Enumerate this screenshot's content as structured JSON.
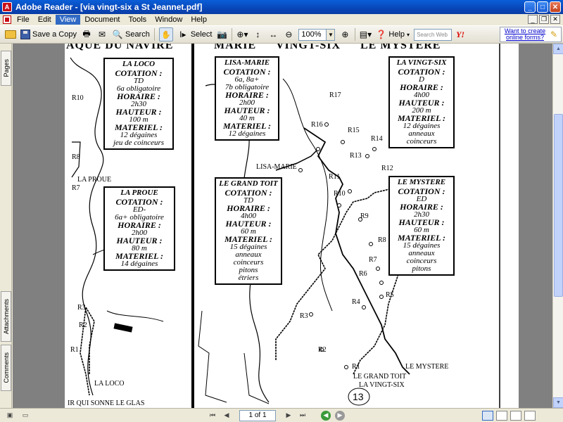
{
  "window": {
    "title": "Adobe Reader - [via vingt-six a St Jeannet.pdf]",
    "app_icon": "adobe-reader-icon"
  },
  "menu": {
    "items": [
      "File",
      "Edit",
      "View",
      "Document",
      "Tools",
      "Window",
      "Help"
    ],
    "active": "View"
  },
  "toolbar": {
    "save_copy_label": "Save a Copy",
    "search_label": "Search",
    "select_label": "Select",
    "zoom_value": "100%",
    "help_label": "Help",
    "search_web_placeholder": "Search Web",
    "yahoo_label": "Y!",
    "promo_text": "Want to create online forms?"
  },
  "nav_panel": {
    "tabs": [
      "Pages",
      "Attachments",
      "Comments"
    ]
  },
  "status": {
    "page_indicator": "1 of 1"
  },
  "topo": {
    "headers": {
      "left": "AQUE DU NAVIRE",
      "mid1": "MARIE",
      "mid2": "VINGT-SIX",
      "mid3": "LE MYSTERE"
    },
    "footer_left": "IR QUI SONNE LE GLAS",
    "page_number": "13",
    "boxes": {
      "la_loco": {
        "title": "LA LOCO",
        "lines": [
          {
            "k": "COTATION :",
            "v": "TD"
          },
          {
            "k": "",
            "v": "6a obligatoire"
          },
          {
            "k": "HORAIRE :",
            "v": "2h30"
          },
          {
            "k": "HAUTEUR :",
            "v": "100 m"
          },
          {
            "k": "MATERIEL :",
            "v": "12 dégaines"
          },
          {
            "k": "",
            "v": "jeu de coinceurs"
          }
        ]
      },
      "la_proue": {
        "title": "LA PROUE",
        "lines": [
          {
            "k": "COTATION :",
            "v": "ED-"
          },
          {
            "k": "",
            "v": "6a+ obligatoire"
          },
          {
            "k": "HORAIRE :",
            "v": "2h00"
          },
          {
            "k": "HAUTEUR :",
            "v": "80 m"
          },
          {
            "k": "MATERIEL :",
            "v": "14 dégaines"
          }
        ]
      },
      "lisa_marie": {
        "title": "LISA-MARIE",
        "lines": [
          {
            "k": "COTATION :",
            "v": "6a, 8a+"
          },
          {
            "k": "",
            "v": "7b obligatoire"
          },
          {
            "k": "HORAIRE :",
            "v": "2h00"
          },
          {
            "k": "HAUTEUR :",
            "v": "40 m"
          },
          {
            "k": "MATERIEL :",
            "v": "12 dégaines"
          }
        ]
      },
      "la_vingt_six": {
        "title": "LA VINGT-SIX",
        "lines": [
          {
            "k": "COTATION :",
            "v": "D"
          },
          {
            "k": "HORAIRE :",
            "v": "4h00"
          },
          {
            "k": "HAUTEUR :",
            "v": "200 m"
          },
          {
            "k": "MATERIEL :",
            "v": "12 dégaines"
          },
          {
            "k": "",
            "v": "anneaux"
          },
          {
            "k": "",
            "v": "coinceurs"
          }
        ]
      },
      "le_grand_toit": {
        "title": "LE GRAND TOIT",
        "lines": [
          {
            "k": "COTATION :",
            "v": "TD"
          },
          {
            "k": "HORAIRE :",
            "v": "4h00"
          },
          {
            "k": "HAUTEUR :",
            "v": "60 m"
          },
          {
            "k": "MATERIEL :",
            "v": "15 dégaines"
          },
          {
            "k": "",
            "v": "anneaux"
          },
          {
            "k": "",
            "v": "coinceurs"
          },
          {
            "k": "",
            "v": "pitons"
          },
          {
            "k": "",
            "v": "étriers"
          }
        ]
      },
      "le_mystere": {
        "title": "LE MYSTERE",
        "lines": [
          {
            "k": "COTATION :",
            "v": "ED"
          },
          {
            "k": "HORAIRE :",
            "v": "2h30"
          },
          {
            "k": "HAUTEUR :",
            "v": "60 m"
          },
          {
            "k": "MATERIEL :",
            "v": "15 dégaines"
          },
          {
            "k": "",
            "v": "anneaux"
          },
          {
            "k": "",
            "v": "coinceurs"
          },
          {
            "k": "",
            "v": "pitons"
          }
        ]
      }
    },
    "labels": {
      "r10_left": "R10",
      "r8_left": "R8",
      "r7_left": "R7",
      "la_proue": "LA PROUE",
      "r3_left": "R3",
      "r2_left": "R2",
      "r1_left": "R1",
      "la_loco": "LA LOCO",
      "r17": "R17",
      "r16": "R16",
      "r15": "R15",
      "r14": "R14",
      "r13": "R13",
      "r12": "R12",
      "r11": "R11",
      "r10": "R10",
      "r9": "R9",
      "r8": "R8",
      "r7": "R7",
      "r6": "R6",
      "r5": "R5",
      "r4": "R4",
      "r3": "R3",
      "r2": "R2",
      "r1": "R1",
      "lisa_marie": "LISA-MARIE",
      "le_mystere": "LE MYSTERE",
      "le_grand_toit": "LE GRAND TOIT",
      "la_vingt_six": "LA VINGT-SIX"
    }
  }
}
